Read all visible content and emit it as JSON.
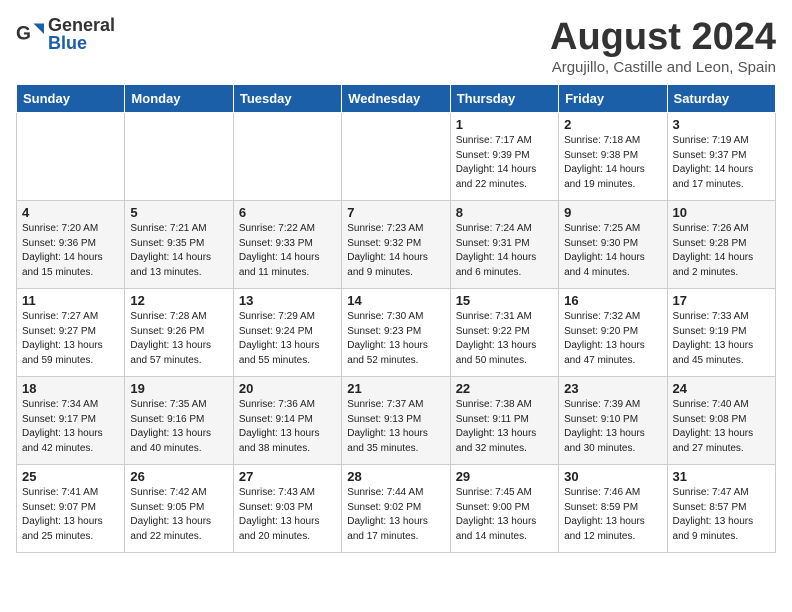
{
  "header": {
    "logo_general": "General",
    "logo_blue": "Blue",
    "month_title": "August 2024",
    "location": "Argujillo, Castille and Leon, Spain"
  },
  "weekdays": [
    "Sunday",
    "Monday",
    "Tuesday",
    "Wednesday",
    "Thursday",
    "Friday",
    "Saturday"
  ],
  "weeks": [
    [
      {
        "day": "",
        "info": ""
      },
      {
        "day": "",
        "info": ""
      },
      {
        "day": "",
        "info": ""
      },
      {
        "day": "",
        "info": ""
      },
      {
        "day": "1",
        "info": "Sunrise: 7:17 AM\nSunset: 9:39 PM\nDaylight: 14 hours\nand 22 minutes."
      },
      {
        "day": "2",
        "info": "Sunrise: 7:18 AM\nSunset: 9:38 PM\nDaylight: 14 hours\nand 19 minutes."
      },
      {
        "day": "3",
        "info": "Sunrise: 7:19 AM\nSunset: 9:37 PM\nDaylight: 14 hours\nand 17 minutes."
      }
    ],
    [
      {
        "day": "4",
        "info": "Sunrise: 7:20 AM\nSunset: 9:36 PM\nDaylight: 14 hours\nand 15 minutes."
      },
      {
        "day": "5",
        "info": "Sunrise: 7:21 AM\nSunset: 9:35 PM\nDaylight: 14 hours\nand 13 minutes."
      },
      {
        "day": "6",
        "info": "Sunrise: 7:22 AM\nSunset: 9:33 PM\nDaylight: 14 hours\nand 11 minutes."
      },
      {
        "day": "7",
        "info": "Sunrise: 7:23 AM\nSunset: 9:32 PM\nDaylight: 14 hours\nand 9 minutes."
      },
      {
        "day": "8",
        "info": "Sunrise: 7:24 AM\nSunset: 9:31 PM\nDaylight: 14 hours\nand 6 minutes."
      },
      {
        "day": "9",
        "info": "Sunrise: 7:25 AM\nSunset: 9:30 PM\nDaylight: 14 hours\nand 4 minutes."
      },
      {
        "day": "10",
        "info": "Sunrise: 7:26 AM\nSunset: 9:28 PM\nDaylight: 14 hours\nand 2 minutes."
      }
    ],
    [
      {
        "day": "11",
        "info": "Sunrise: 7:27 AM\nSunset: 9:27 PM\nDaylight: 13 hours\nand 59 minutes."
      },
      {
        "day": "12",
        "info": "Sunrise: 7:28 AM\nSunset: 9:26 PM\nDaylight: 13 hours\nand 57 minutes."
      },
      {
        "day": "13",
        "info": "Sunrise: 7:29 AM\nSunset: 9:24 PM\nDaylight: 13 hours\nand 55 minutes."
      },
      {
        "day": "14",
        "info": "Sunrise: 7:30 AM\nSunset: 9:23 PM\nDaylight: 13 hours\nand 52 minutes."
      },
      {
        "day": "15",
        "info": "Sunrise: 7:31 AM\nSunset: 9:22 PM\nDaylight: 13 hours\nand 50 minutes."
      },
      {
        "day": "16",
        "info": "Sunrise: 7:32 AM\nSunset: 9:20 PM\nDaylight: 13 hours\nand 47 minutes."
      },
      {
        "day": "17",
        "info": "Sunrise: 7:33 AM\nSunset: 9:19 PM\nDaylight: 13 hours\nand 45 minutes."
      }
    ],
    [
      {
        "day": "18",
        "info": "Sunrise: 7:34 AM\nSunset: 9:17 PM\nDaylight: 13 hours\nand 42 minutes."
      },
      {
        "day": "19",
        "info": "Sunrise: 7:35 AM\nSunset: 9:16 PM\nDaylight: 13 hours\nand 40 minutes."
      },
      {
        "day": "20",
        "info": "Sunrise: 7:36 AM\nSunset: 9:14 PM\nDaylight: 13 hours\nand 38 minutes."
      },
      {
        "day": "21",
        "info": "Sunrise: 7:37 AM\nSunset: 9:13 PM\nDaylight: 13 hours\nand 35 minutes."
      },
      {
        "day": "22",
        "info": "Sunrise: 7:38 AM\nSunset: 9:11 PM\nDaylight: 13 hours\nand 32 minutes."
      },
      {
        "day": "23",
        "info": "Sunrise: 7:39 AM\nSunset: 9:10 PM\nDaylight: 13 hours\nand 30 minutes."
      },
      {
        "day": "24",
        "info": "Sunrise: 7:40 AM\nSunset: 9:08 PM\nDaylight: 13 hours\nand 27 minutes."
      }
    ],
    [
      {
        "day": "25",
        "info": "Sunrise: 7:41 AM\nSunset: 9:07 PM\nDaylight: 13 hours\nand 25 minutes."
      },
      {
        "day": "26",
        "info": "Sunrise: 7:42 AM\nSunset: 9:05 PM\nDaylight: 13 hours\nand 22 minutes."
      },
      {
        "day": "27",
        "info": "Sunrise: 7:43 AM\nSunset: 9:03 PM\nDaylight: 13 hours\nand 20 minutes."
      },
      {
        "day": "28",
        "info": "Sunrise: 7:44 AM\nSunset: 9:02 PM\nDaylight: 13 hours\nand 17 minutes."
      },
      {
        "day": "29",
        "info": "Sunrise: 7:45 AM\nSunset: 9:00 PM\nDaylight: 13 hours\nand 14 minutes."
      },
      {
        "day": "30",
        "info": "Sunrise: 7:46 AM\nSunset: 8:59 PM\nDaylight: 13 hours\nand 12 minutes."
      },
      {
        "day": "31",
        "info": "Sunrise: 7:47 AM\nSunset: 8:57 PM\nDaylight: 13 hours\nand 9 minutes."
      }
    ]
  ]
}
